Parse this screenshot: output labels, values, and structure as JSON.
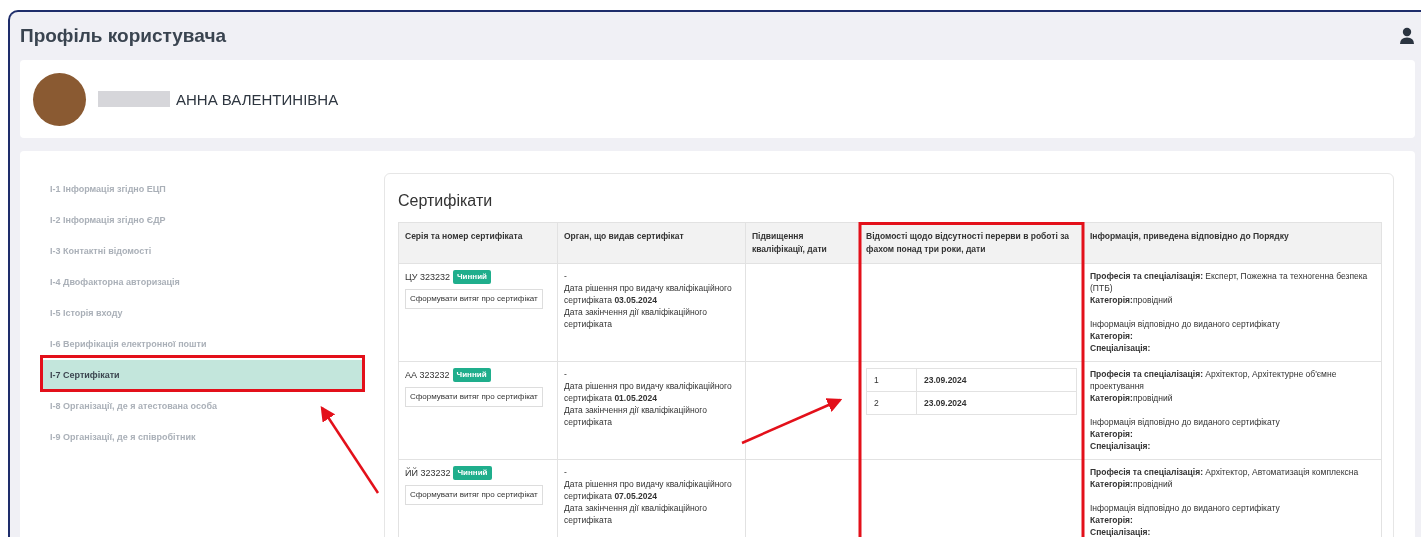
{
  "page": {
    "title": "Профіль користувача"
  },
  "profile": {
    "name": "АННА ВАЛЕНТИНІВНА"
  },
  "sidebar": {
    "items": [
      {
        "label": "І-1 Інформація згідно ЕЦП",
        "selected": false
      },
      {
        "label": "І-2 Інформація згідно ЄДР",
        "selected": false
      },
      {
        "label": "І-3 Контактні відомості",
        "selected": false
      },
      {
        "label": "І-4 Двофакторна авторизація",
        "selected": false
      },
      {
        "label": "І-5 Історія входу",
        "selected": false
      },
      {
        "label": "І-6 Верифікація електронної пошти",
        "selected": false
      },
      {
        "label": "І-7 Сертифікати",
        "selected": true
      },
      {
        "label": "І-8 Організації, де я атестована особа",
        "selected": false
      },
      {
        "label": "І-9 Організації, де я співробітник",
        "selected": false
      }
    ]
  },
  "certificates": {
    "title": "Сертифікати",
    "columns": [
      "Серія та номер сертифіката",
      "Орган, що видав сертифікат",
      "Підвищення кваліфікації, дати",
      "Відомості щодо відсутності перерви в роботі за фахом понад три роки, дати",
      "Інформація, приведена відповідно до Порядку"
    ],
    "rows": [
      {
        "number": "ЦУ 323232",
        "status": "Чинний",
        "extract_button": "Сформувати витяг про сертифікат",
        "issuer": {
          "dash": "-",
          "decision": "Дата рішення про видачу кваліфікаційного сертифіката **03.05.2024**",
          "expiry": "Дата закінчення дії кваліфікаційного сертифіката"
        },
        "breaks": [],
        "info": {
          "profession": "**Професія та спеціалізація:** Експерт, Пожежна та техногенна безпека (ПТБ)",
          "category": "**Категорія:**провідний",
          "note": "Інформація відповідно до виданого сертифікату",
          "cert_category": "Категорія:",
          "cert_specialization": "Спеціалізація:"
        }
      },
      {
        "number": "АА 323232",
        "status": "Чинний",
        "extract_button": "Сформувати витяг про сертифікат",
        "issuer": {
          "dash": "-",
          "decision": "Дата рішення про видачу кваліфікаційного сертифіката **01.05.2024**",
          "expiry": "Дата закінчення дії кваліфікаційного сертифіката"
        },
        "breaks": [
          {
            "index": "1",
            "date": "23.09.2024"
          },
          {
            "index": "2",
            "date": "23.09.2024"
          }
        ],
        "info": {
          "profession": "**Професія та спеціалізація:** Архітектор, Архітектурне об'ємне проектування",
          "category": "**Категорія:**провідний",
          "note": "Інформація відповідно до виданого сертифікату",
          "cert_category": "Категорія:",
          "cert_specialization": "Спеціалізація:"
        }
      },
      {
        "number": "ЙЙ 323232",
        "status": "Чинний",
        "extract_button": "Сформувати витяг про сертифікат",
        "issuer": {
          "dash": "-",
          "decision": "Дата рішення про видачу кваліфікаційного сертифіката **07.05.2024**",
          "expiry": "Дата закінчення дії кваліфікаційного сертифіката"
        },
        "breaks": [],
        "info": {
          "profession": "**Професія та спеціалізація:** Архітектор, Автоматизація комплексна",
          "category": "**Категорія:**провідний",
          "note": "Інформація відповідно до виданого сертифікату",
          "cert_category": "Категорія:",
          "cert_specialization": "Спеціалізація:"
        }
      }
    ]
  }
}
